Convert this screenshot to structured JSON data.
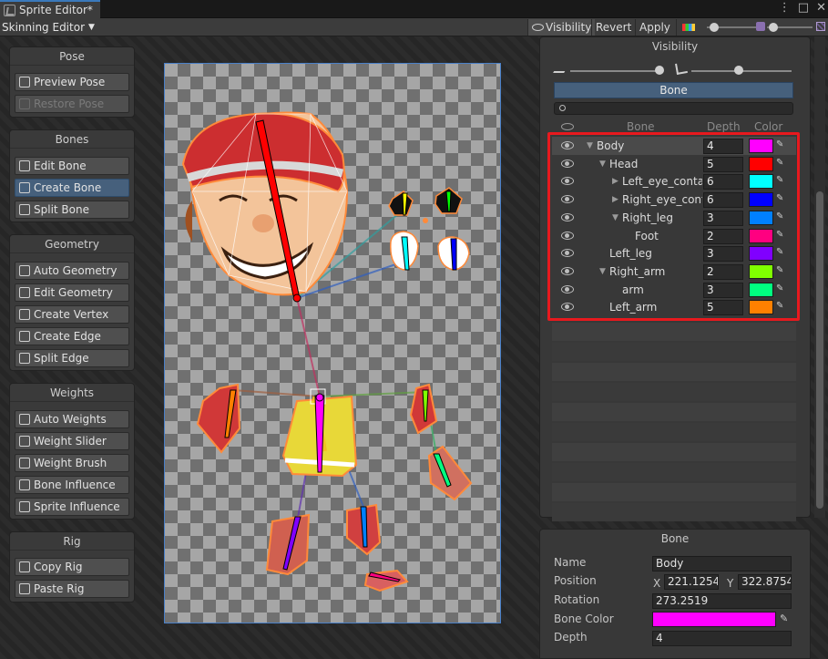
{
  "window": {
    "title": "Sprite Editor*",
    "controls": [
      "⋮",
      "□",
      "✕"
    ]
  },
  "toolbar": {
    "mode": "Skinning Editor",
    "visibility_label": "Visibility",
    "revert_label": "Revert",
    "apply_label": "Apply",
    "color_icon": "color-palette-icon"
  },
  "tools": {
    "pose": {
      "title": "Pose",
      "items": [
        "Preview Pose",
        "Restore Pose"
      ]
    },
    "bones": {
      "title": "Bones",
      "items": [
        "Edit Bone",
        "Create Bone",
        "Split Bone"
      ],
      "active": "Create Bone"
    },
    "geometry": {
      "title": "Geometry",
      "items": [
        "Auto Geometry",
        "Edit Geometry",
        "Create Vertex",
        "Create Edge",
        "Split Edge"
      ]
    },
    "weights": {
      "title": "Weights",
      "items": [
        "Auto Weights",
        "Weight Slider",
        "Weight Brush",
        "Bone Influence",
        "Sprite Influence"
      ]
    },
    "rig": {
      "title": "Rig",
      "items": [
        "Copy Rig",
        "Paste Rig"
      ]
    }
  },
  "visibility": {
    "title": "Visibility",
    "tab": "Bone",
    "search_placeholder": "",
    "columns": {
      "bone": "Bone",
      "depth": "Depth",
      "color": "Color"
    },
    "bones": [
      {
        "name": "Body",
        "depth": "4",
        "color": "#ff00ff",
        "indent": 0,
        "arrow": "▼"
      },
      {
        "name": "Head",
        "depth": "5",
        "color": "#ff0000",
        "indent": 1,
        "arrow": "▼"
      },
      {
        "name": "Left_eye_conta",
        "depth": "6",
        "color": "#00ffff",
        "indent": 2,
        "arrow": "▶"
      },
      {
        "name": "Right_eye_cont",
        "depth": "6",
        "color": "#0000ff",
        "indent": 2,
        "arrow": "▶"
      },
      {
        "name": "Right_leg",
        "depth": "3",
        "color": "#0080ff",
        "indent": 2,
        "arrow": "▼"
      },
      {
        "name": "Foot",
        "depth": "2",
        "color": "#ff0080",
        "indent": 3,
        "arrow": ""
      },
      {
        "name": "Left_leg",
        "depth": "3",
        "color": "#8000ff",
        "indent": 1,
        "arrow": ""
      },
      {
        "name": "Right_arm",
        "depth": "2",
        "color": "#80ff00",
        "indent": 1,
        "arrow": "▼"
      },
      {
        "name": "arm",
        "depth": "3",
        "color": "#00ff80",
        "indent": 2,
        "arrow": ""
      },
      {
        "name": "Left_arm",
        "depth": "5",
        "color": "#ff8000",
        "indent": 1,
        "arrow": ""
      }
    ]
  },
  "bone_panel": {
    "title": "Bone",
    "name_label": "Name",
    "name": "Body",
    "position_label": "Position",
    "x_label": "X",
    "x": "221.1254",
    "y_label": "Y",
    "y": "322.8754",
    "rotation_label": "Rotation",
    "rotation": "273.2519",
    "color_label": "Bone Color",
    "color": "#ff00ff",
    "depth_label": "Depth",
    "depth": "4"
  }
}
